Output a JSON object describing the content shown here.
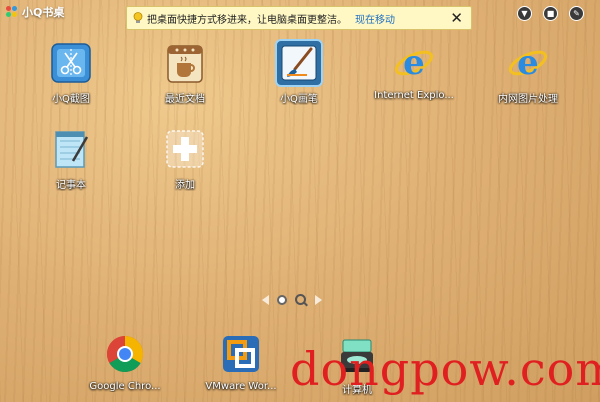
{
  "window": {
    "title": "小Q书桌"
  },
  "notice": {
    "text": "把桌面快捷方式移进来，让电脑桌面更整洁。",
    "link": "现在移动",
    "close": "✕"
  },
  "toolbar": {
    "btn1": "▼",
    "btn2": "■",
    "btn3": "✎"
  },
  "apps": [
    {
      "label": "小Q截图",
      "icon": "screenshot-icon"
    },
    {
      "label": "最近文档",
      "icon": "recent-docs-icon"
    },
    {
      "label": "小Q画笔",
      "icon": "paint-brush-icon"
    },
    {
      "label": "Internet Explo...",
      "icon": "internet-explorer-icon"
    },
    {
      "label": "内网图片处理",
      "icon": "internet-explorer-icon"
    },
    {
      "label": "记事本",
      "icon": "notepad-icon"
    },
    {
      "label": "添加",
      "icon": "add-icon"
    }
  ],
  "dock": [
    {
      "label": "Google Chro...",
      "icon": "chrome-icon"
    },
    {
      "label": "VMware Wor...",
      "icon": "vmware-icon"
    },
    {
      "label": "计算机",
      "icon": "computer-icon"
    }
  ],
  "watermark": "dongpow.com"
}
